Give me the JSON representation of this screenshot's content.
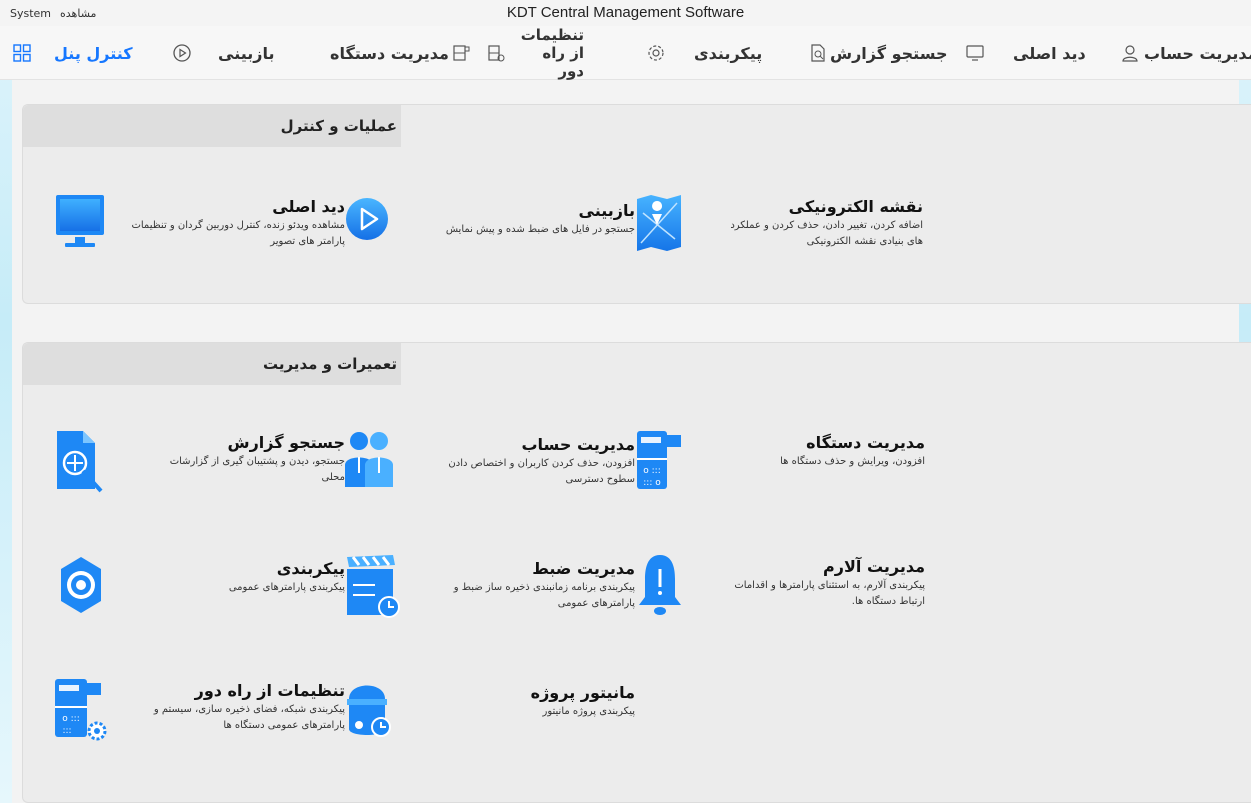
{
  "titlebar": {
    "menu_system": "System",
    "menu_view": "مشاهده",
    "app_title": "KDT Central Management Software"
  },
  "nav": {
    "control_panel": "کنترل پنل",
    "playback": "بازبینی",
    "device_management": "مدیریت دستگاه",
    "remote_settings": "تنظیمات از راه دور",
    "configuration": "پیکربندی",
    "report_search": "جستجو گزارش",
    "main_view": "دید اصلی",
    "account_management": "مدیریت حساب"
  },
  "section_ops": {
    "title": "عملیات و کنترل",
    "cards": [
      {
        "title": "نقشه الکترونیکی",
        "desc": "اضافه کردن، تغییر دادن، حذف کردن و عملکرد های بنیادی نقشه الکترونیکی",
        "icon": "map-icon"
      },
      {
        "title": "بازبینی",
        "desc": "جستجو در فایل های ضبط شده و پیش نمایش",
        "icon": "playback-icon"
      },
      {
        "title": "دید اصلی",
        "desc": "مشاهده ویدئو زنده، کنترل دوربین گردان و تنظیمات پارامتر های تصویر",
        "icon": "monitor-icon"
      }
    ]
  },
  "section_maint": {
    "title": "تعمیرات و مدیریت",
    "cards": [
      {
        "title": "مدیریت دستگاه",
        "desc": "افزودن، ویرایش و حذف دستگاه ها",
        "icon": "device-icon"
      },
      {
        "title": "مدیریت حساب",
        "desc": "افزودن، حذف کردن کاربران و اختصاص دادن سطوح دسترسی",
        "icon": "users-icon"
      },
      {
        "title": "جستجو گزارش",
        "desc": "جستجو، دیدن و پشتیبان گیری از گزارشات محلی",
        "icon": "report-icon"
      },
      {
        "title": "مدیریت آلارم",
        "desc": "پیکربندی آلارم، به استثنای پارامترها و اقدامات ارتباط دستگاه ها.",
        "icon": "bell-icon"
      },
      {
        "title": "مدیریت ضبط",
        "desc": "پیکربندی برنامه زمانبندی ذخیره ساز ضبط و پارامترهای عمومی",
        "icon": "clapper-icon"
      },
      {
        "title": "پیکربندی",
        "desc": "پیکربندی پارامترهای عمومی",
        "icon": "gear-icon"
      },
      {
        "title": "مانیتور پروژه",
        "desc": "پیکربندی پروژه مانیتور",
        "icon": "camera-monitor-icon"
      },
      {
        "title": "تنظیمات از راه دور",
        "desc": "پیکربندی شبکه، فضای ذخیره سازی، سیستم و پارامترهای عمومی دستگاه ها",
        "icon": "remote-settings-icon"
      }
    ]
  },
  "colors": {
    "accent": "#1677ff",
    "icon_blue": "#1e88f5"
  }
}
